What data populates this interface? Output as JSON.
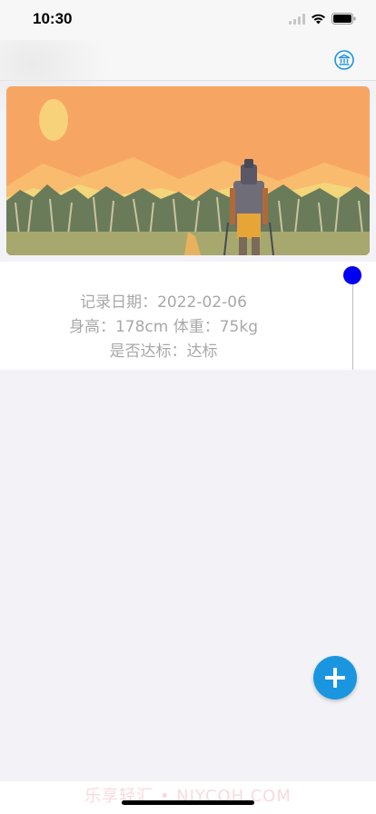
{
  "status_bar": {
    "time": "10:30"
  },
  "nav": {
    "action_icon": "bank-icon"
  },
  "banner": {
    "scene": "illustration-hiker-mountains-sunset"
  },
  "record": {
    "date_line": "记录日期：2022-02-06",
    "measure_line": "身高：178cm 体重：75kg",
    "status_line": "是否达标：达标"
  },
  "fab": {
    "icon": "plus-icon"
  },
  "watermark": {
    "text": "乐享轻汇 • NJYCOH.COM"
  },
  "colors": {
    "accent": "#1a96e0",
    "timeline_dot": "#0000f5",
    "text_secondary": "#a8a8a8",
    "background": "#f2f2f7"
  }
}
